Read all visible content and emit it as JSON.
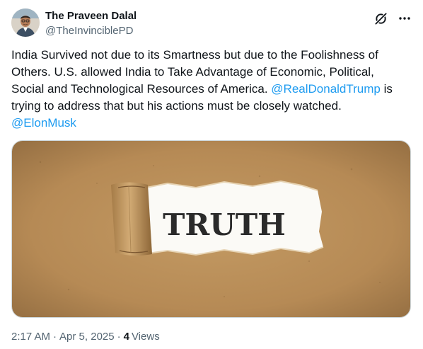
{
  "author": {
    "display_name": "The Praveen Dalal",
    "handle": "@TheInvinciblePD"
  },
  "header_icons": [
    "grok-icon",
    "more-icon"
  ],
  "tweet": {
    "text_before": "India Survived not due to its Smartness but due to the Foolishness of Others. U.S. allowed India to Take Advantage of Economic, Political, Social and Technological Resources of America. ",
    "mention_1": "@RealDonaldTrump",
    "text_middle": " is trying to address that but his actions must be closely watched.",
    "mention_2": "@ElonMusk"
  },
  "media": {
    "word": "TRUTH"
  },
  "meta": {
    "time": "2:17 AM",
    "separator": "·",
    "date": "Apr 5, 2025",
    "views_count": "4",
    "views_label": "Views"
  },
  "colors": {
    "accent": "#1d9bf0",
    "text": "#0f1419",
    "muted": "#536471",
    "cardboard": "#b98d57"
  }
}
